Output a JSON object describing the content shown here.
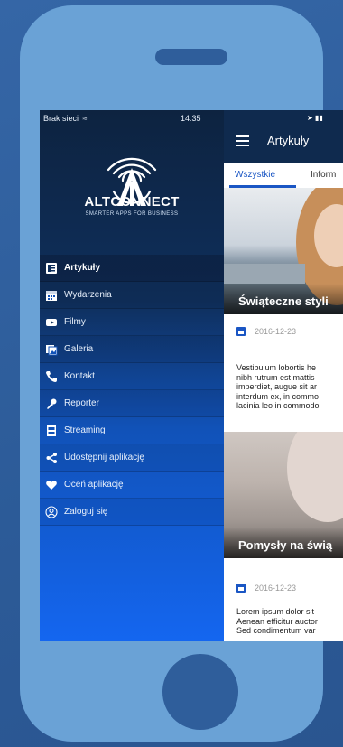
{
  "drawer": {
    "status_left": "Brak sieci",
    "time": "14:35",
    "brand": "ALTCONNECT",
    "tagline": "SMARTER APPS FOR BUSINESS",
    "items": [
      {
        "label": "Artykuły",
        "icon": "articles-icon",
        "active": true
      },
      {
        "label": "Wydarzenia",
        "icon": "calendar-icon"
      },
      {
        "label": "Filmy",
        "icon": "video-icon"
      },
      {
        "label": "Galeria",
        "icon": "gallery-icon"
      },
      {
        "label": "Kontakt",
        "icon": "phone-icon"
      },
      {
        "label": "Reporter",
        "icon": "microphone-icon"
      },
      {
        "label": "Streaming",
        "icon": "streaming-icon"
      },
      {
        "label": "Udostępnij aplikację",
        "icon": "share-icon"
      },
      {
        "label": "Oceń aplikację",
        "icon": "heart-icon"
      },
      {
        "label": "Zaloguj się",
        "icon": "user-icon"
      }
    ]
  },
  "content": {
    "title": "Artykuły",
    "tabs": [
      "Wszystkie",
      "Inform"
    ],
    "articles": [
      {
        "title": "Świąteczne styli",
        "date": "2016-12-23",
        "excerpt": [
          "Vestibulum lobortis he",
          "nibh rutrum est mattis",
          "imperdiet, augue sit ar",
          "interdum ex, in commo",
          "lacinia leo in commodo"
        ]
      },
      {
        "title": "Pomysły na świą",
        "date": "2016-12-23",
        "excerpt": [
          "Lorem ipsum dolor sit",
          "Aenean efficitur auctor",
          "Sed condimentum var"
        ]
      }
    ]
  },
  "colors": {
    "accent": "#1a56c4",
    "topbar": "#0f2a4e",
    "phone_body": "#6aa2d6",
    "background": "#2e5f9e"
  }
}
